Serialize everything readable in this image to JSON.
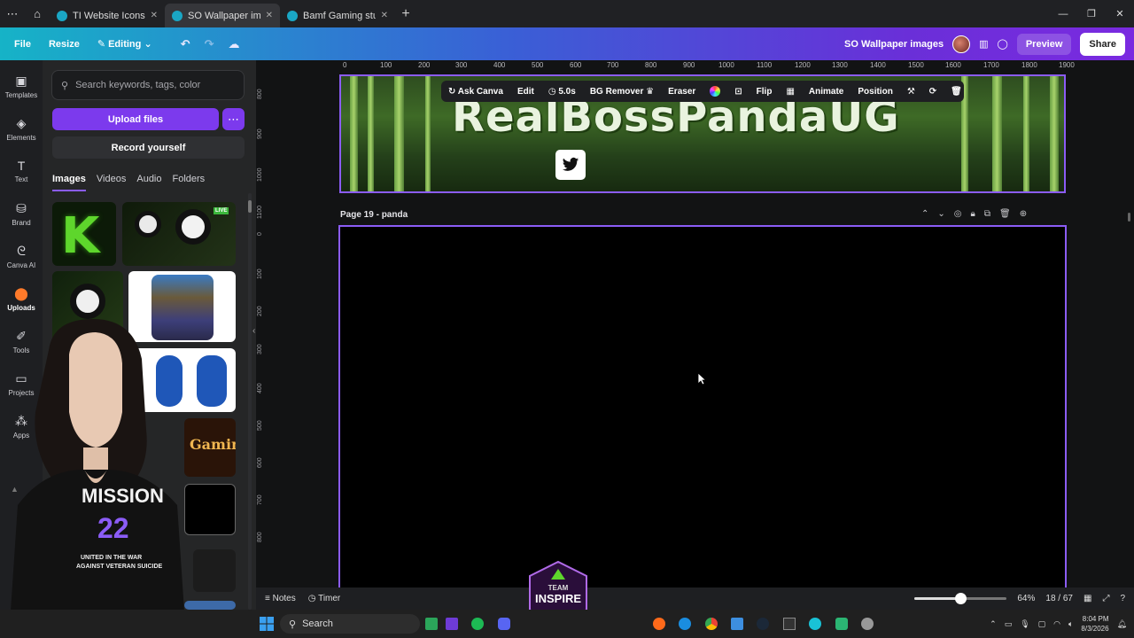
{
  "browser": {
    "tabs": [
      {
        "label": "TI Website Icons - ...",
        "active": false
      },
      {
        "label": "SO Wallpaper imag...",
        "active": true
      },
      {
        "label": "Bamf Gaming stuff ...",
        "active": false
      }
    ]
  },
  "topbar": {
    "file": "File",
    "resize": "Resize",
    "editing": "Editing",
    "project_title": "SO Wallpaper images",
    "preview": "Preview",
    "share": "Share"
  },
  "rail": [
    {
      "label": "Templates",
      "icon": "templates-icon"
    },
    {
      "label": "Elements",
      "icon": "elements-icon"
    },
    {
      "label": "Text",
      "icon": "text-icon"
    },
    {
      "label": "Brand",
      "icon": "brand-icon"
    },
    {
      "label": "Canva AI",
      "icon": "canva-ai-icon"
    },
    {
      "label": "Uploads",
      "icon": "uploads-icon",
      "active": true
    },
    {
      "label": "Tools",
      "icon": "tools-icon"
    },
    {
      "label": "Projects",
      "icon": "projects-icon"
    },
    {
      "label": "Apps",
      "icon": "apps-icon"
    }
  ],
  "panel": {
    "search_placeholder": "Search keywords, tags, color",
    "upload_files": "Upload files",
    "record_yourself": "Record yourself",
    "tabs": [
      "Images",
      "Videos",
      "Audio",
      "Folders"
    ],
    "active_tab": "Images"
  },
  "webcam_shirt": {
    "line1": "MISSION",
    "line2": "22",
    "line3": "UNITED IN THE WAR",
    "line4": "AGAINST VETERAN SUICIDE"
  },
  "thumb_text": {
    "k_logo": "K",
    "gaming": "Gaming",
    "live": "LIVE"
  },
  "canvas": {
    "ruler_ticks": [
      "0",
      "100",
      "200",
      "300",
      "400",
      "500",
      "600",
      "700",
      "800",
      "900",
      "1000",
      "1100",
      "1200",
      "1300",
      "1400",
      "1500",
      "1600",
      "1700",
      "1800",
      "1900"
    ],
    "ruler_left_ticks": [
      "800",
      "900",
      "1000",
      "1100",
      "0",
      "100",
      "200",
      "300",
      "400",
      "500",
      "600",
      "700",
      "800"
    ],
    "page18_title": "RealBossPandaUG",
    "page19_label": "Page 19 - panda"
  },
  "context_toolbar": {
    "ask_canva": "Ask Canva",
    "edit": "Edit",
    "duration": "5.0s",
    "bg_remover": "BG Remover",
    "eraser": "Eraser",
    "flip": "Flip",
    "animate": "Animate",
    "position": "Position"
  },
  "statusbar": {
    "notes": "Notes",
    "timer": "Timer",
    "zoom": "64%",
    "zoom_fraction": 0.5,
    "pages": "18 / 67"
  },
  "logo_badge": {
    "top": "TEAM",
    "main": "INSPIRE"
  },
  "taskbar": {
    "search": "Search",
    "time": "8:04 PM",
    "date": "8/3/2026"
  },
  "colors": {
    "accent_purple": "#8b5cf6",
    "upload_button": "#7c3aed",
    "topbar_start": "#16b3c7",
    "topbar_end": "#7a2ae0"
  }
}
